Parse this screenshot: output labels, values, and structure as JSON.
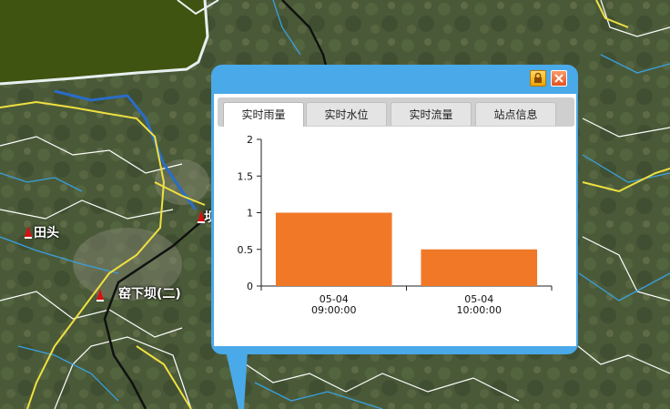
{
  "map": {
    "markers": [
      {
        "name": "田头"
      },
      {
        "name": "窑下坝(二)"
      },
      {
        "name": "坝"
      }
    ]
  },
  "popup": {
    "buttons": {
      "lock": "lock-icon",
      "close": "close-icon"
    },
    "tabs": [
      {
        "label": "实时雨量",
        "active": true
      },
      {
        "label": "实时水位",
        "active": false
      },
      {
        "label": "实时流量",
        "active": false
      },
      {
        "label": "站点信息",
        "active": false
      }
    ]
  },
  "colors": {
    "popup_frame": "#4aa9e8",
    "bar": "#f07827"
  },
  "chart_data": {
    "type": "bar",
    "categories": [
      [
        "05-04",
        "09:00:00"
      ],
      [
        "05-04",
        "10:00:00"
      ]
    ],
    "values": [
      1,
      0.5
    ],
    "ylim": [
      0,
      2
    ],
    "yticks": [
      0,
      0.5,
      1,
      1.5,
      2
    ],
    "ytick_labels": [
      "0",
      "0.5",
      "1",
      "1.5",
      "2"
    ],
    "grid": false,
    "legend": "none"
  }
}
